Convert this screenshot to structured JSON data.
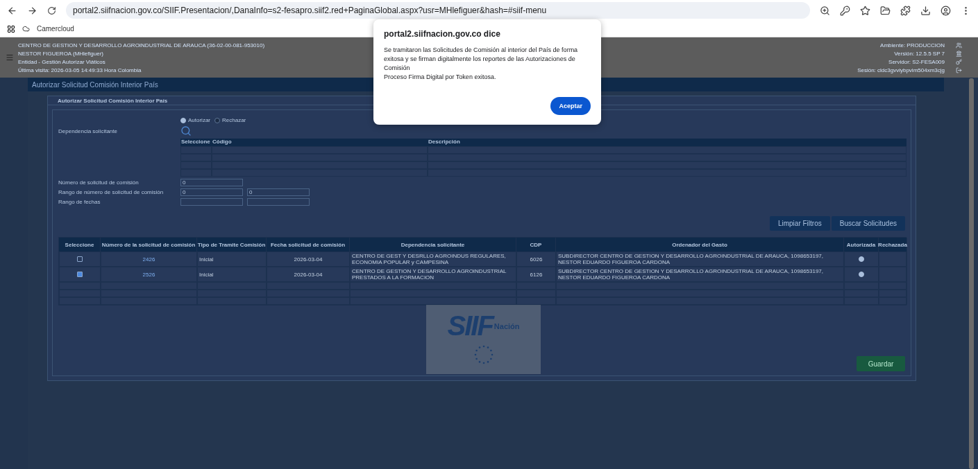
{
  "browser": {
    "url": "portal2.siifnacion.gov.co/SIIF.Presentacion/,DanaInfo=s2-fesapro.siif2.red+PaginaGlobal.aspx?usr=MHlefiguer&hash=#siif-menu",
    "bookmarks": [
      "Camercloud"
    ]
  },
  "header": {
    "lines": [
      "CENTRO DE GESTION Y DESARROLLO AGROINDUSTRIAL DE ARAUCA (36-02-00-081-953010)",
      "NESTOR FIGUEROA (MHlefiguer)",
      "Entidad - Gestión Autorizar Viáticos",
      "Última visita: 2026-03-05 14:49:33 Hora Colombia"
    ],
    "info": [
      "Ambiente: PRODUCCION",
      "Versión: 12.5.5 SP 7",
      "Servidor: S2-FESA009",
      "Sesión: cldc3gvviybpvim504xm3cjg"
    ]
  },
  "page": {
    "title": "Autorizar Solicitud Comisión Interior País",
    "panel_title": "Autorizar Solicitud Comisión Interior País",
    "radios": [
      {
        "label": "Autorizar",
        "selected": true
      },
      {
        "label": "Rechazar",
        "selected": false
      }
    ],
    "dependency_label": "Dependencia solicitante",
    "dependency_columns": [
      "Seleccione",
      "Código",
      "Descripción"
    ],
    "fields": [
      {
        "label": "Número de solicitud de comisión",
        "kind": "single",
        "values": [
          "0"
        ]
      },
      {
        "label": "Rango de número de solicitud de comisión",
        "kind": "range",
        "values": [
          "0",
          "0"
        ]
      },
      {
        "label": "Rango de fechas",
        "kind": "range"
      }
    ],
    "buttons": [
      "Limpiar Filtros",
      "Buscar Solicitudes"
    ],
    "columns": [
      "Seleccione",
      "Número de la solicitud de comisión",
      "Tipo de Tramite Comisión",
      "Fecha solicitud de comisión",
      "Dependencia solicitante",
      "CDP",
      "Ordenador del Gasto",
      "Autorizada",
      "Rechazada"
    ],
    "rows": [
      {
        "selected": false,
        "number": "2426",
        "type": "Inicial",
        "date": "2026-03-04",
        "dependency": "CENTRO DE GEST Y DESRLLO AGROINDUS REGULARES, ECONOMIA POPULAR y CAMPESINA",
        "cdp": "6026",
        "orderer": "SUBDIRECTOR CENTRO DE GESTION Y DESARROLLO AGROINDUSTRIAL DE ARAUCA, 1098653197, NESTOR EDUARDO FIGUEROA CARDONA",
        "authorized": true
      },
      {
        "selected": true,
        "number": "2526",
        "type": "Inicial",
        "date": "2026-03-04",
        "dependency": "CENTRO DE GESTION Y DESARROLLO AGROINDUSTRIAL PRESTADOS A LA FORMACION",
        "cdp": "6126",
        "orderer": "SUBDIRECTOR CENTRO DE GESTION Y DESARROLLO AGROINDUSTRIAL DE ARAUCA, 1098653197, NESTOR EDUARDO FIGUEROA CARDONA",
        "authorized": true
      }
    ],
    "save_button": "Guardar"
  },
  "loading": {
    "logo": "SIIF",
    "logo_sub": "Nación"
  },
  "dialog": {
    "title": "portal2.siifnacion.gov.co dice",
    "message": [
      "Se tramitaron las Solicitudes de Comisión al interior del País de forma exitosa y se firman digitalmente los reportes de las Autorizaciones de Comisión",
      "Proceso Firma Digital por Token exitosa."
    ],
    "button": "Aceptar"
  }
}
